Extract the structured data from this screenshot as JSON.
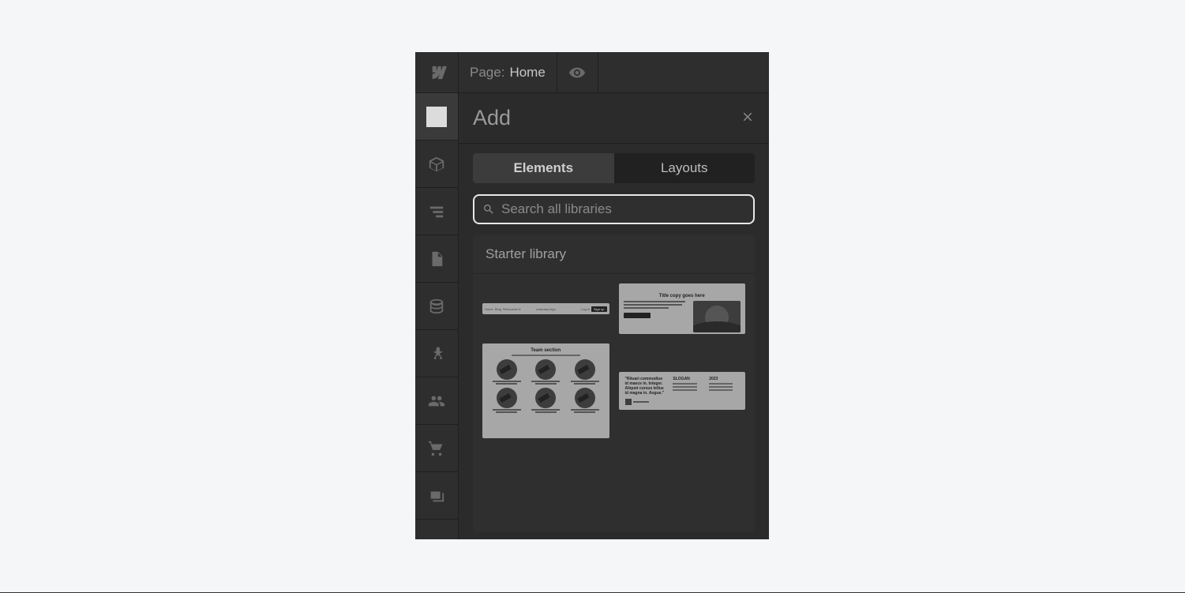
{
  "topbar": {
    "page_label": "Page:",
    "page_value": "Home"
  },
  "panel": {
    "title": "Add",
    "tabs": {
      "elements": "Elements",
      "layouts": "Layouts"
    },
    "search": {
      "placeholder": "Search all libraries"
    },
    "library": {
      "title": "Starter library",
      "thumbs": {
        "hero_title": "Title copy goes here",
        "team_title": "Team section",
        "quote": "\"Rituari commodius id maece in. Integer. Aliquet cursus tellus id magna in. Augue.\"",
        "footer_col1": "SLOGAN",
        "footer_col2": "2023"
      }
    }
  },
  "sidebar": {
    "icons": [
      "add",
      "components",
      "navigator",
      "pages",
      "cms",
      "interactions",
      "users",
      "ecommerce",
      "assets"
    ]
  }
}
